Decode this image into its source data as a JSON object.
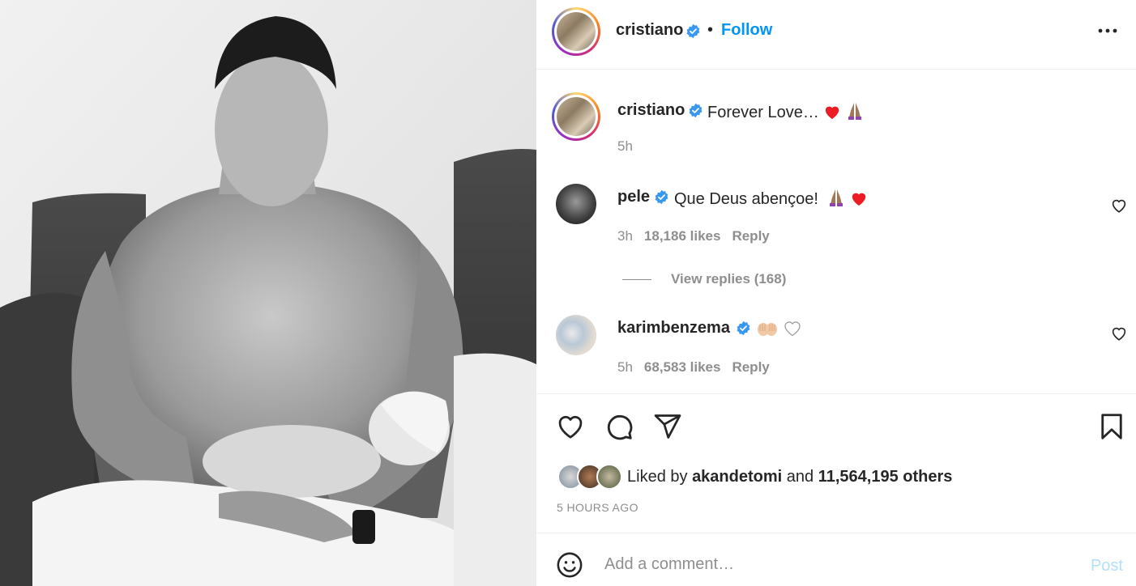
{
  "post": {
    "author": "cristiano",
    "follow_label": "Follow",
    "separator": "•",
    "caption": {
      "text": "Forever Love…",
      "time": "5h"
    },
    "comments": [
      {
        "username": "pele",
        "text": "Que Deus abençoe!",
        "time": "3h",
        "likes": "18,186 likes",
        "reply_label": "Reply",
        "view_replies": "View replies (168)"
      },
      {
        "username": "karimbenzema",
        "text": "",
        "time": "5h",
        "likes": "68,583 likes",
        "reply_label": "Reply"
      }
    ],
    "likes": {
      "prefix": "Liked by",
      "user": "akandetomi",
      "conjunction": "and",
      "others": "11,564,195 others"
    },
    "time_ago": "5 HOURS AGO",
    "add_comment": {
      "placeholder": "Add a comment…",
      "post_label": "Post"
    }
  },
  "colors": {
    "accent": "#0095f6",
    "verified": "#3897f0",
    "muted": "#8e8e8e",
    "heart_red": "#ed1c24",
    "post_disabled": "#b2dffc"
  },
  "icons": [
    "verified-badge-icon",
    "more-options-icon",
    "heart-icon",
    "comment-icon",
    "share-icon",
    "bookmark-icon",
    "smiley-icon"
  ]
}
